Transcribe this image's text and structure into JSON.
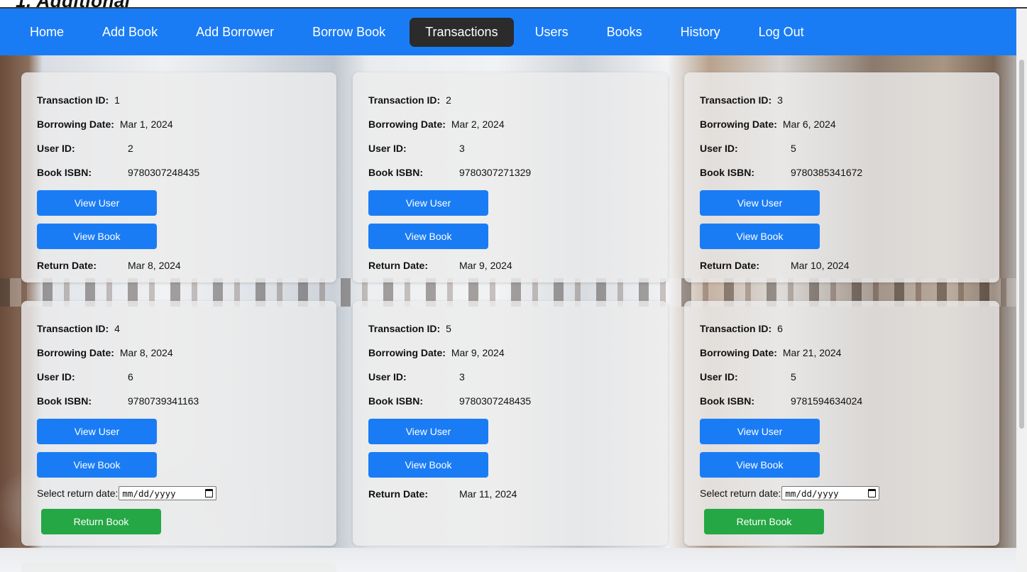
{
  "page_header": {
    "title_fragment": "1. Additional"
  },
  "nav": {
    "items": [
      {
        "label": "Home"
      },
      {
        "label": "Add Book"
      },
      {
        "label": "Add Borrower"
      },
      {
        "label": "Borrow Book"
      },
      {
        "label": "Transactions",
        "active": true
      },
      {
        "label": "Users"
      },
      {
        "label": "Books"
      },
      {
        "label": "History"
      },
      {
        "label": "Log Out"
      }
    ]
  },
  "labels": {
    "transaction_id": "Transaction ID:",
    "borrowing_date": "Borrowing Date:",
    "user_id": "User ID:",
    "book_isbn": "Book ISBN:",
    "return_date": "Return Date:",
    "view_user": "View User",
    "view_book": "View Book",
    "select_return_date": "Select return date:",
    "return_book": "Return Book",
    "date_placeholder": "mm/dd/yyyy"
  },
  "transactions": [
    {
      "id": "1",
      "borrowing_date": "Mar 1, 2024",
      "user_id": "2",
      "isbn": "9780307248435",
      "return_date": "Mar 8, 2024"
    },
    {
      "id": "2",
      "borrowing_date": "Mar 2, 2024",
      "user_id": "3",
      "isbn": "9780307271329",
      "return_date": "Mar 9, 2024"
    },
    {
      "id": "3",
      "borrowing_date": "Mar 6, 2024",
      "user_id": "5",
      "isbn": "9780385341672",
      "return_date": "Mar 10, 2024"
    },
    {
      "id": "4",
      "borrowing_date": "Mar 8, 2024",
      "user_id": "6",
      "isbn": "9780739341163",
      "return_date": null
    },
    {
      "id": "5",
      "borrowing_date": "Mar 9, 2024",
      "user_id": "3",
      "isbn": "9780307248435",
      "return_date": "Mar 11, 2024"
    },
    {
      "id": "6",
      "borrowing_date": "Mar 21, 2024",
      "user_id": "5",
      "isbn": "9781594634024",
      "return_date": null
    }
  ],
  "colors": {
    "nav_bg": "#1a7cf5",
    "active_tab": "#2b2b2b",
    "primary_button": "#1a7cf5",
    "return_button": "#24a744"
  },
  "icons": {
    "date_picker": "calendar-icon"
  }
}
